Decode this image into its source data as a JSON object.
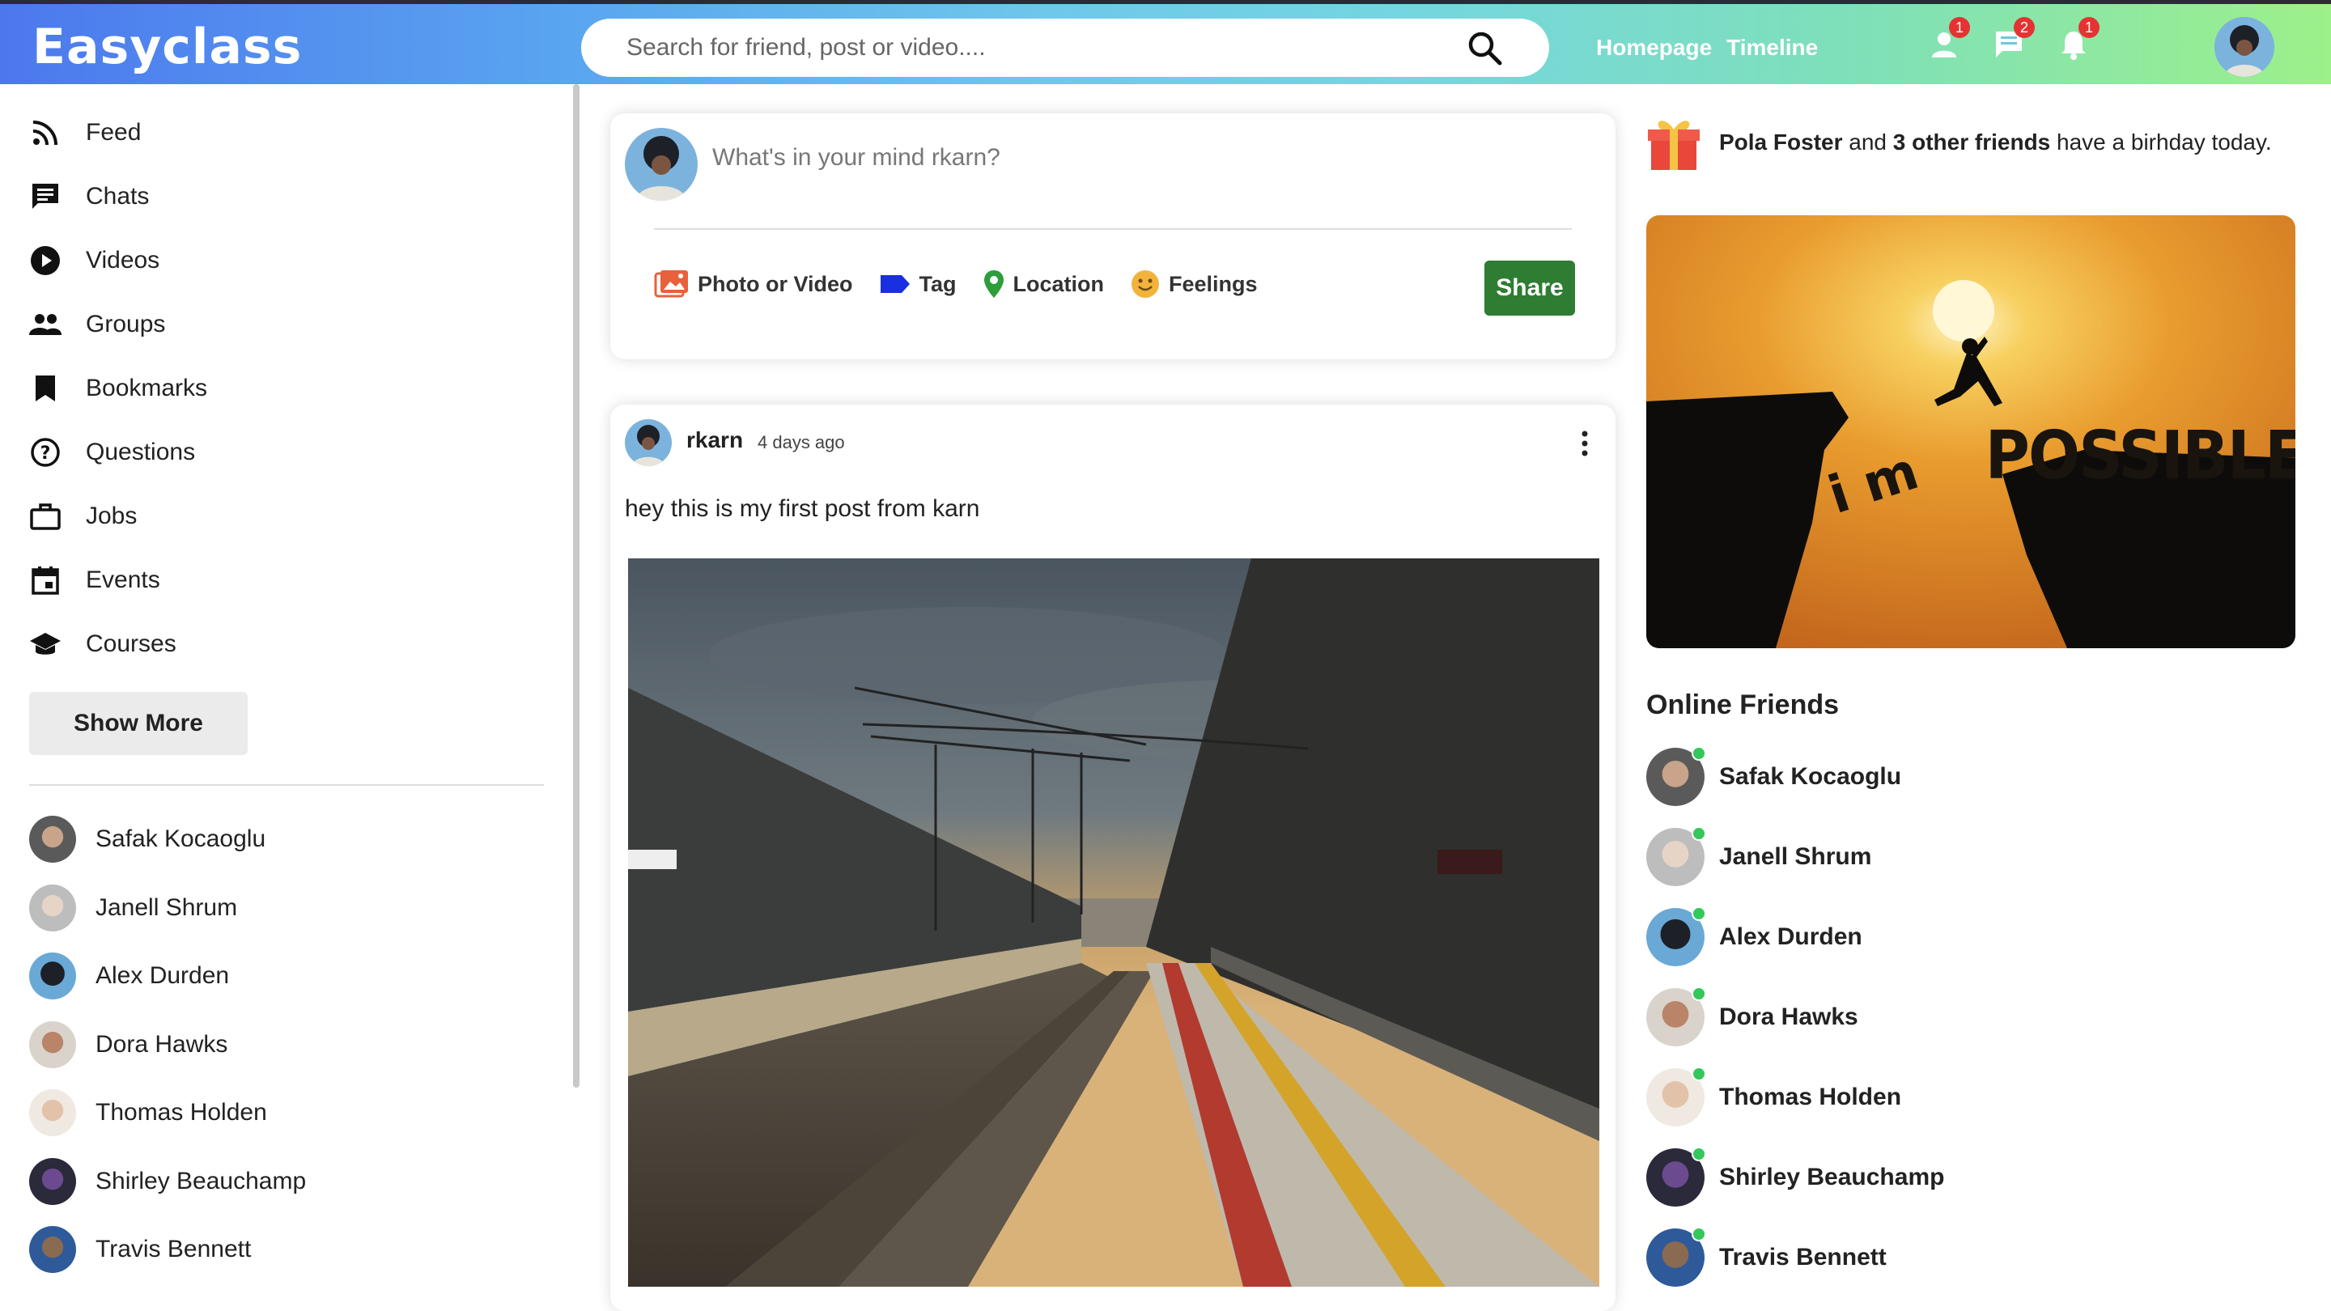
{
  "app": {
    "logo": "Easyclass"
  },
  "header": {
    "search_placeholder": "Search for friend, post or video....",
    "nav": [
      "Homepage",
      "Timeline"
    ],
    "badges": {
      "friends": "1",
      "messages": "2",
      "notifications": "1"
    }
  },
  "sidebar": {
    "items": [
      {
        "label": "Feed",
        "icon": "rss-icon"
      },
      {
        "label": "Chats",
        "icon": "chat-icon"
      },
      {
        "label": "Videos",
        "icon": "play-circle-icon"
      },
      {
        "label": "Groups",
        "icon": "group-icon"
      },
      {
        "label": "Bookmarks",
        "icon": "bookmark-icon"
      },
      {
        "label": "Questions",
        "icon": "question-circle-icon"
      },
      {
        "label": "Jobs",
        "icon": "briefcase-icon"
      },
      {
        "label": "Events",
        "icon": "calendar-icon"
      },
      {
        "label": "Courses",
        "icon": "graduation-cap-icon"
      }
    ],
    "show_more": "Show More",
    "friends": [
      "Safak Kocaoglu",
      "Janell Shrum",
      "Alex Durden",
      "Dora Hawks",
      "Thomas Holden",
      "Shirley Beauchamp",
      "Travis Bennett"
    ]
  },
  "composer": {
    "placeholder": "What's in your mind rkarn?",
    "options": {
      "photo": "Photo or Video",
      "tag": "Tag",
      "location": "Location",
      "feelings": "Feelings"
    },
    "share": "Share"
  },
  "post": {
    "username": "rkarn",
    "time": "4 days ago",
    "text": "hey this is my first post from karn"
  },
  "rightbar": {
    "birthday": {
      "name": "Pola Foster",
      "mid": " and ",
      "others": "3 other friends",
      "tail": " have a birhday today."
    },
    "ad_text": {
      "small": "i m",
      "big": "POSSIBLE"
    },
    "online_title": "Online Friends",
    "online": [
      "Safak Kocaoglu",
      "Janell Shrum",
      "Alex Durden",
      "Dora Hawks",
      "Thomas Holden",
      "Shirley Beauchamp",
      "Travis Bennett"
    ]
  },
  "colors": {
    "share": "#2e7d32",
    "badge": "#e53232",
    "online": "#34c759"
  }
}
